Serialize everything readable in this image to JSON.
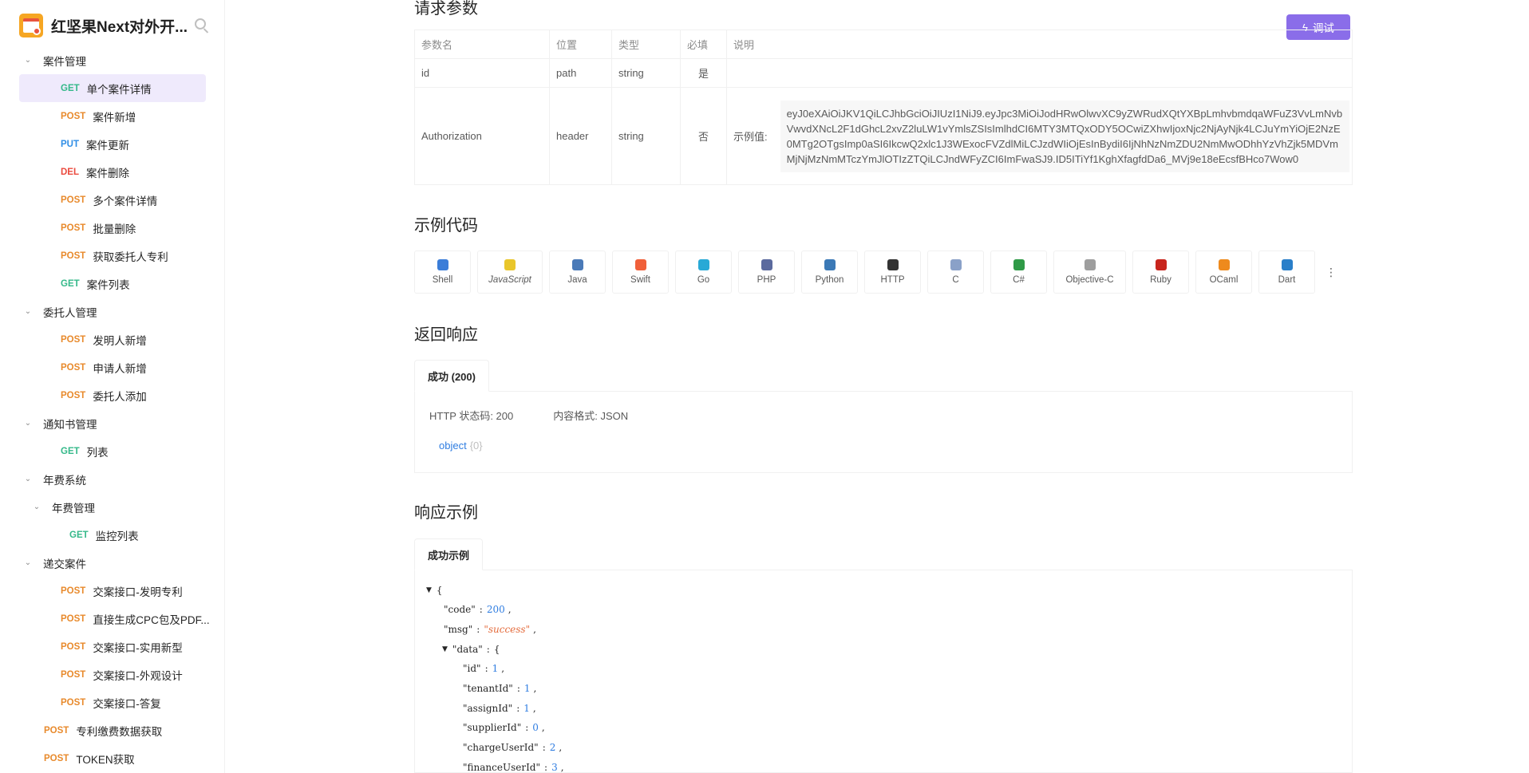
{
  "sidebar": {
    "project_name": "红坚果Next对外开...",
    "tree": [
      {
        "type": "folder",
        "depth": 0,
        "label": "案件管理"
      },
      {
        "type": "api",
        "depth": 1,
        "method": "GET",
        "label": "单个案件详情",
        "active": true
      },
      {
        "type": "api",
        "depth": 1,
        "method": "POST",
        "label": "案件新增"
      },
      {
        "type": "api",
        "depth": 1,
        "method": "PUT",
        "label": "案件更新"
      },
      {
        "type": "api",
        "depth": 1,
        "method": "DEL",
        "label": "案件删除"
      },
      {
        "type": "api",
        "depth": 1,
        "method": "POST",
        "label": "多个案件详情"
      },
      {
        "type": "api",
        "depth": 1,
        "method": "POST",
        "label": "批量删除"
      },
      {
        "type": "api",
        "depth": 1,
        "method": "POST",
        "label": "获取委托人专利"
      },
      {
        "type": "api",
        "depth": 1,
        "method": "GET",
        "label": "案件列表"
      },
      {
        "type": "folder",
        "depth": 0,
        "label": "委托人管理"
      },
      {
        "type": "api",
        "depth": 1,
        "method": "POST",
        "label": "发明人新增"
      },
      {
        "type": "api",
        "depth": 1,
        "method": "POST",
        "label": "申请人新增"
      },
      {
        "type": "api",
        "depth": 1,
        "method": "POST",
        "label": "委托人添加"
      },
      {
        "type": "folder",
        "depth": 0,
        "label": "通知书管理"
      },
      {
        "type": "api",
        "depth": 1,
        "method": "GET",
        "label": "列表"
      },
      {
        "type": "folder",
        "depth": 0,
        "label": "年费系统"
      },
      {
        "type": "folder",
        "depth": 1,
        "label": "年费管理"
      },
      {
        "type": "api",
        "depth": 2,
        "method": "GET",
        "label": "监控列表"
      },
      {
        "type": "folder",
        "depth": 0,
        "label": "递交案件"
      },
      {
        "type": "api",
        "depth": 1,
        "method": "POST",
        "label": "交案接口-发明专利"
      },
      {
        "type": "api",
        "depth": 1,
        "method": "POST",
        "label": "直接生成CPC包及PDF..."
      },
      {
        "type": "api",
        "depth": 1,
        "method": "POST",
        "label": "交案接口-实用新型"
      },
      {
        "type": "api",
        "depth": 1,
        "method": "POST",
        "label": "交案接口-外观设计"
      },
      {
        "type": "api",
        "depth": 1,
        "method": "POST",
        "label": "交案接口-答复"
      },
      {
        "type": "api",
        "depth": 0,
        "method": "POST",
        "label": "专利缴费数据获取"
      },
      {
        "type": "api",
        "depth": 0,
        "method": "POST",
        "label": "TOKEN获取"
      }
    ]
  },
  "main": {
    "request_params_title": "请求参数",
    "debug_button": "调试",
    "params_table": {
      "headers": [
        "参数名",
        "位置",
        "类型",
        "必填",
        "说明"
      ],
      "rows": [
        {
          "name": "id",
          "location": "path",
          "type": "string",
          "required": "是",
          "desc": ""
        },
        {
          "name": "Authorization",
          "location": "header",
          "type": "string",
          "required": "否",
          "example_label": "示例值:",
          "example": "eyJ0eXAiOiJKV1QiLCJhbGciOiJIUzI1NiJ9.eyJpc3MiOiJodHRwOlwvXC9yZWRudXQtYXBpLmhvbmdqaWFuZ3VvLmNvbVwvdXNcL2F1dGhcL2xvZ2luLW1vYmlsZSIsImlhdCI6MTY3MTQxODY5OCwiZXhwIjoxNjc2NjAyNjk4LCJuYmYiOjE2NzE0MTg2OTgsImp0aSI6IkcwQ2xlc1J3WExocFVZdlMiLCJzdWIiOjEsInBydiI6IjNhNzNmZDU2NmMwODhhYzVhZjk5MDVmMjNjMzNmMTczYmJlOTIzZTQiLCJndWFyZCI6ImFwaSJ9.ID5ITiYf1KghXfagfdDa6_MVj9e18eEcsfBHco7Wow0"
        }
      ]
    },
    "code_sample_title": "示例代码",
    "languages": [
      {
        "name": "Shell",
        "icon": "shell-icon",
        "color": "#3b7dd8"
      },
      {
        "name": "JavaScript",
        "icon": "js-icon",
        "color": "#e9c62b"
      },
      {
        "name": "Java",
        "icon": "java-icon",
        "color": "#4a7ab8"
      },
      {
        "name": "Swift",
        "icon": "swift-icon",
        "color": "#f0603a"
      },
      {
        "name": "Go",
        "icon": "go-icon",
        "color": "#28a9d6"
      },
      {
        "name": "PHP",
        "icon": "php-icon",
        "color": "#5b6a9e"
      },
      {
        "name": "Python",
        "icon": "python-icon",
        "color": "#3b79b6"
      },
      {
        "name": "HTTP",
        "icon": "http-icon",
        "color": "#333333"
      },
      {
        "name": "C",
        "icon": "c-icon",
        "color": "#8aa1c8"
      },
      {
        "name": "C#",
        "icon": "csharp-icon",
        "color": "#2f9a47"
      },
      {
        "name": "Objective-C",
        "icon": "objc-icon",
        "color": "#9e9e9e"
      },
      {
        "name": "Ruby",
        "icon": "ruby-icon",
        "color": "#c8251d"
      },
      {
        "name": "OCaml",
        "icon": "ocaml-icon",
        "color": "#ee8a1d"
      },
      {
        "name": "Dart",
        "icon": "dart-icon",
        "color": "#2a7fc9"
      }
    ],
    "response_title": "返回响应",
    "response_tab": "成功 (200)",
    "http_status": "HTTP 状态码: 200",
    "content_type": "内容格式: JSON",
    "object_label": "object",
    "object_count": "{0}",
    "example_title": "响应示例",
    "example_tab": "成功示例",
    "json_lines": [
      {
        "indent": 0,
        "tri": true,
        "text": "{"
      },
      {
        "indent": 1,
        "key": "\"code\"",
        "num": "200",
        "tail": ","
      },
      {
        "indent": 1,
        "key": "\"msg\"",
        "str": "\"success\"",
        "tail": ","
      },
      {
        "indent": 1,
        "tri": true,
        "key": "\"data\"",
        "text": "{"
      },
      {
        "indent": 2,
        "key": "\"id\"",
        "num": "1",
        "tail": ","
      },
      {
        "indent": 2,
        "key": "\"tenantId\"",
        "num": "1",
        "tail": ","
      },
      {
        "indent": 2,
        "key": "\"assignId\"",
        "num": "1",
        "tail": ","
      },
      {
        "indent": 2,
        "key": "\"supplierId\"",
        "num": "0",
        "tail": ","
      },
      {
        "indent": 2,
        "key": "\"chargeUserId\"",
        "num": "2",
        "tail": ","
      },
      {
        "indent": 2,
        "key": "\"financeUserId\"",
        "num": "3",
        "tail": ","
      }
    ]
  }
}
